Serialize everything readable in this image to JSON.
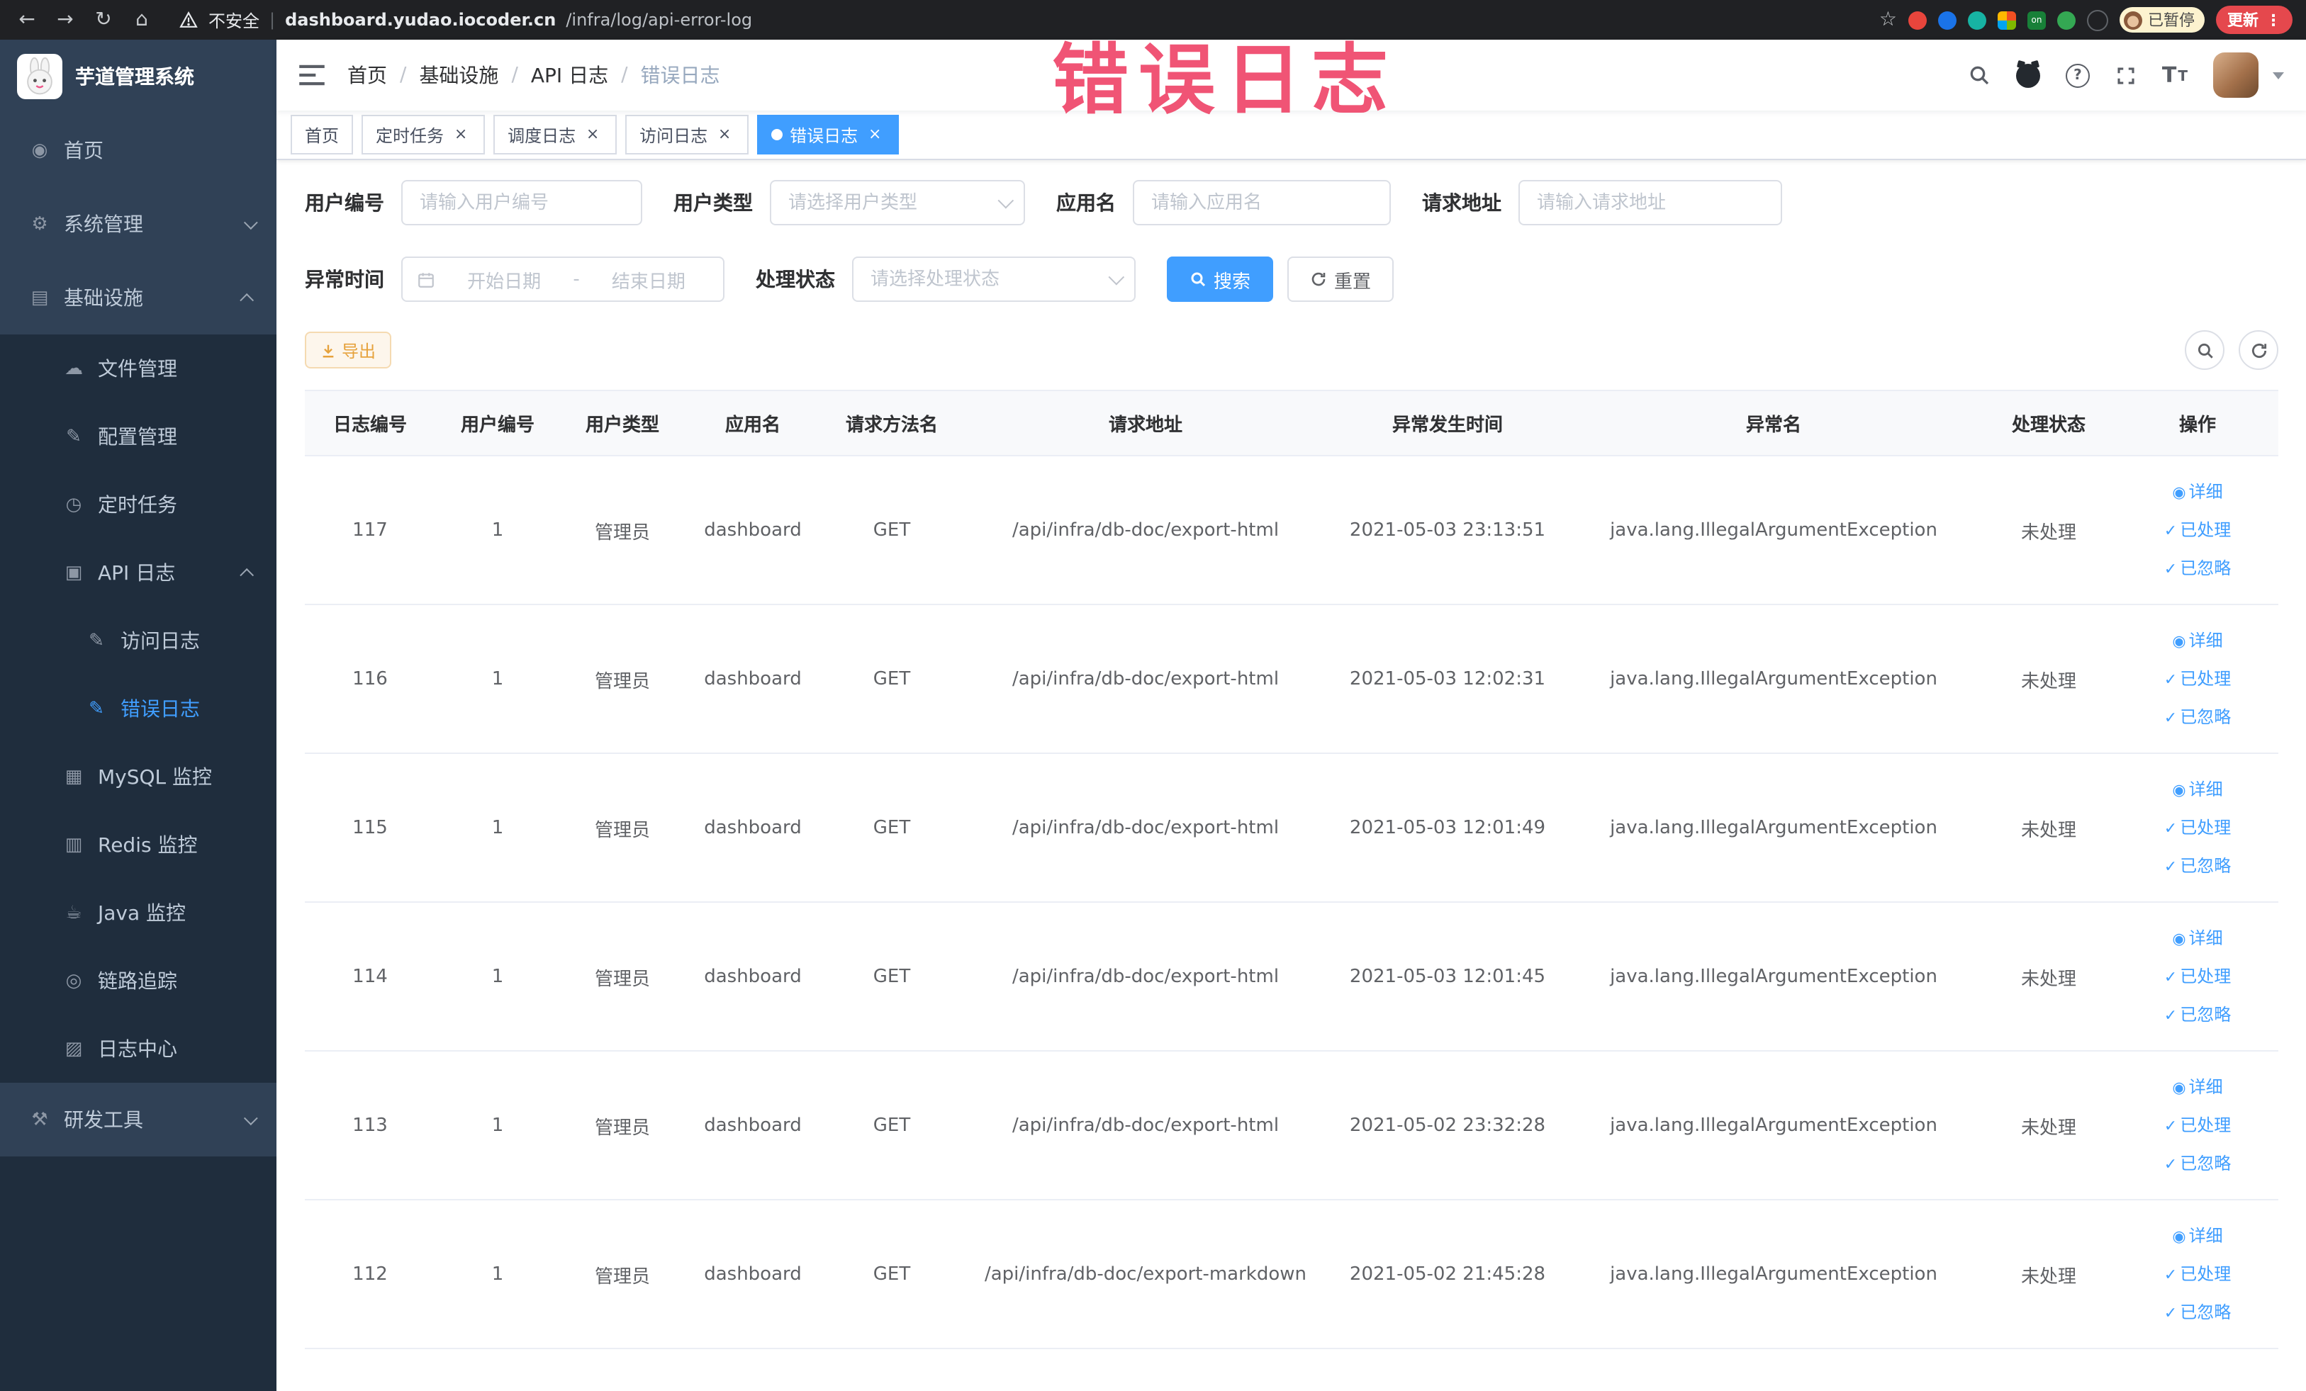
{
  "annotation": {
    "text": "错误日志"
  },
  "browser": {
    "security_label": "不安全",
    "url_domain": "dashboard.yudao.iocoder.cn",
    "url_path": "/infra/log/api-error-log",
    "paused_badge": "已暂停",
    "update_button": "更新"
  },
  "icons": {
    "back": "←",
    "forward": "→",
    "reload": "↻",
    "home": "⌂",
    "star": "☆",
    "menu_dots": "⋮",
    "dashboard": "◉",
    "gear": "⚙",
    "infra": "▤",
    "cloud": "☁",
    "edit": "✎",
    "clock": "◷",
    "api_log": "▣",
    "doc_edit": "✎",
    "mysql": "▦",
    "redis": "▥",
    "java": "☕",
    "trace": "◎",
    "log_center": "▨",
    "tools": "⚒",
    "check": "✓",
    "view": "◉"
  },
  "sidebar": {
    "logo_title": "芋道管理系统",
    "items": [
      {
        "label": "首页"
      },
      {
        "label": "系统管理"
      },
      {
        "label": "基础设施"
      },
      {
        "label": "文件管理"
      },
      {
        "label": "配置管理"
      },
      {
        "label": "定时任务"
      },
      {
        "label": "API 日志"
      },
      {
        "label": "访问日志"
      },
      {
        "label": "错误日志"
      },
      {
        "label": "MySQL 监控"
      },
      {
        "label": "Redis 监控"
      },
      {
        "label": "Java 监控"
      },
      {
        "label": "链路追踪"
      },
      {
        "label": "日志中心"
      },
      {
        "label": "研发工具"
      }
    ]
  },
  "navbar": {
    "breadcrumb": [
      "首页",
      "基础设施",
      "API 日志",
      "错误日志"
    ],
    "separator": "/"
  },
  "tabs": [
    {
      "label": "首页"
    },
    {
      "label": "定时任务"
    },
    {
      "label": "调度日志"
    },
    {
      "label": "访问日志"
    },
    {
      "label": "错误日志"
    }
  ],
  "filters": {
    "user_id": {
      "label": "用户编号",
      "placeholder": "请输入用户编号"
    },
    "user_type": {
      "label": "用户类型",
      "placeholder": "请选择用户类型"
    },
    "app_name": {
      "label": "应用名",
      "placeholder": "请输入应用名"
    },
    "request_url": {
      "label": "请求地址",
      "placeholder": "请输入请求地址"
    },
    "exception_time": {
      "label": "异常时间",
      "start_placeholder": "开始日期",
      "separator": "-",
      "end_placeholder": "结束日期"
    },
    "process_status": {
      "label": "处理状态",
      "placeholder": "请选择处理状态"
    },
    "search_button": "搜索",
    "reset_button": "重置"
  },
  "toolbar": {
    "export_label": "导出"
  },
  "table": {
    "columns": [
      "日志编号",
      "用户编号",
      "用户类型",
      "应用名",
      "请求方法名",
      "请求地址",
      "异常发生时间",
      "异常名",
      "处理状态",
      "操作"
    ],
    "actions": {
      "detail": "详细",
      "processed": "已处理",
      "ignored": "已忽略"
    },
    "rows": [
      {
        "log_id": "117",
        "user_id": "1",
        "user_type": "管理员",
        "app_name": "dashboard",
        "method": "GET",
        "url": "/api/infra/db-doc/export-html",
        "time": "2021-05-03 23:13:51",
        "exception": "java.lang.IllegalArgumentException",
        "status": "未处理"
      },
      {
        "log_id": "116",
        "user_id": "1",
        "user_type": "管理员",
        "app_name": "dashboard",
        "method": "GET",
        "url": "/api/infra/db-doc/export-html",
        "time": "2021-05-03 12:02:31",
        "exception": "java.lang.IllegalArgumentException",
        "status": "未处理"
      },
      {
        "log_id": "115",
        "user_id": "1",
        "user_type": "管理员",
        "app_name": "dashboard",
        "method": "GET",
        "url": "/api/infra/db-doc/export-html",
        "time": "2021-05-03 12:01:49",
        "exception": "java.lang.IllegalArgumentException",
        "status": "未处理"
      },
      {
        "log_id": "114",
        "user_id": "1",
        "user_type": "管理员",
        "app_name": "dashboard",
        "method": "GET",
        "url": "/api/infra/db-doc/export-html",
        "time": "2021-05-03 12:01:45",
        "exception": "java.lang.IllegalArgumentException",
        "status": "未处理"
      },
      {
        "log_id": "113",
        "user_id": "1",
        "user_type": "管理员",
        "app_name": "dashboard",
        "method": "GET",
        "url": "/api/infra/db-doc/export-html",
        "time": "2021-05-02 23:32:28",
        "exception": "java.lang.IllegalArgumentException",
        "status": "未处理"
      },
      {
        "log_id": "112",
        "user_id": "1",
        "user_type": "管理员",
        "app_name": "dashboard",
        "method": "GET",
        "url": "/api/infra/db-doc/export-markdown",
        "time": "2021-05-02 21:45:28",
        "exception": "java.lang.IllegalArgumentException",
        "status": "未处理"
      }
    ]
  }
}
